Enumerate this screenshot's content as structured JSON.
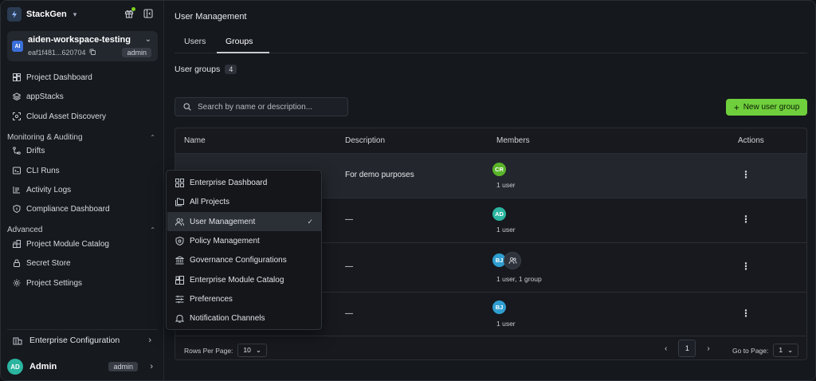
{
  "brand": {
    "name": "StackGen"
  },
  "workspace": {
    "name": "aiden-workspace-testing",
    "id": "eaf1f481...620704",
    "role": "admin",
    "badge": "AI"
  },
  "sidebar": {
    "items_top": [
      {
        "label": "Project Dashboard",
        "icon": "dashboard-icon"
      },
      {
        "label": "appStacks",
        "icon": "layers-icon"
      },
      {
        "label": "Cloud Asset Discovery",
        "icon": "scan-icon"
      }
    ],
    "section_monitoring": {
      "title": "Monitoring & Auditing",
      "items": [
        {
          "label": "Drifts",
          "icon": "drift-icon"
        },
        {
          "label": "CLI Runs",
          "icon": "terminal-icon"
        },
        {
          "label": "Activity Logs",
          "icon": "log-icon"
        },
        {
          "label": "Compliance Dashboard",
          "icon": "shield-icon"
        }
      ]
    },
    "section_advanced": {
      "title": "Advanced",
      "items": [
        {
          "label": "Project Module Catalog",
          "icon": "module-icon"
        },
        {
          "label": "Secret Store",
          "icon": "lock-icon"
        },
        {
          "label": "Project Settings",
          "icon": "gear-icon"
        }
      ]
    },
    "enterprise_config": "Enterprise Configuration",
    "user": {
      "initials": "AD",
      "name": "Admin",
      "role": "admin"
    }
  },
  "main": {
    "title": "User Management",
    "tabs": [
      "Users",
      "Groups"
    ],
    "active_tab": "Groups",
    "groups_label": "User groups",
    "groups_count": "4",
    "search_placeholder": "Search by name or description...",
    "new_button": "New user group",
    "columns": [
      "Name",
      "Description",
      "Members",
      "Actions"
    ],
    "rows": [
      {
        "description": "For demo purposes",
        "avatars": [
          "CR"
        ],
        "members_text": "1 user"
      },
      {
        "description": "—",
        "avatars": [
          "AD"
        ],
        "members_text": "1 user"
      },
      {
        "description": "—",
        "avatars": [
          "BJ"
        ],
        "members_text": "1 user, 1 group"
      },
      {
        "description": "—",
        "avatars": [
          "BJ"
        ],
        "members_text": "1 user"
      }
    ],
    "footer": {
      "rows_per_page_label": "Rows Per Page:",
      "rows_per_page": "10",
      "page": "1",
      "goto_label": "Go to Page:",
      "goto_value": "1"
    }
  },
  "menu": {
    "items": [
      {
        "label": "Enterprise Dashboard",
        "icon": "grid-icon"
      },
      {
        "label": "All Projects",
        "icon": "folders-icon"
      },
      {
        "label": "User Management",
        "icon": "users-icon",
        "selected": true
      },
      {
        "label": "Policy Management",
        "icon": "policy-shield-icon"
      },
      {
        "label": "Governance Configurations",
        "icon": "bank-icon"
      },
      {
        "label": "Enterprise Module Catalog",
        "icon": "blocks-icon"
      },
      {
        "label": "Preferences",
        "icon": "sliders-icon"
      },
      {
        "label": "Notification Channels",
        "icon": "bell-icon"
      }
    ]
  },
  "colors": {
    "accent": "#6fcf3c",
    "avatar_cr": "#5ab52a",
    "avatar_ad": "#2bb5a0",
    "avatar_bj": "#2f9ed0"
  }
}
